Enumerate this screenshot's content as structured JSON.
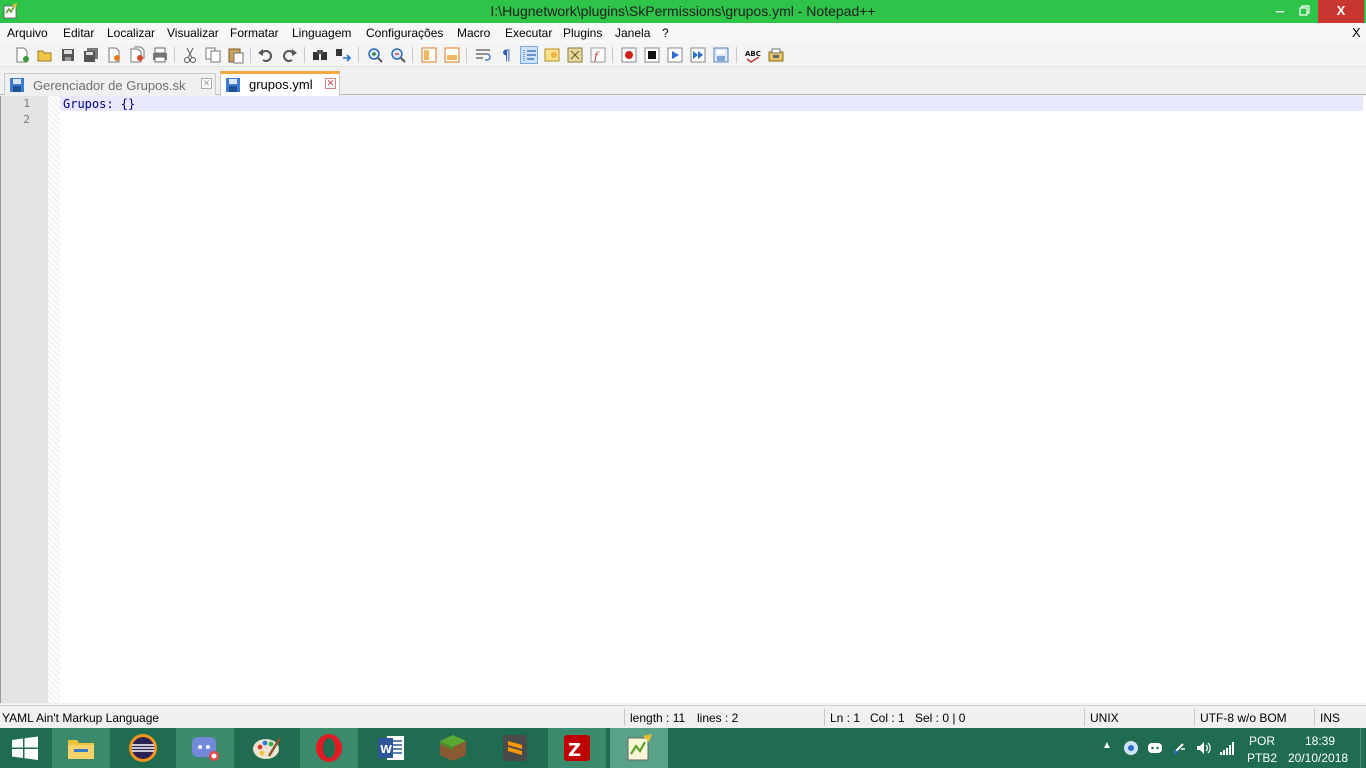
{
  "window": {
    "title": "I:\\Hugnetwork\\plugins\\SkPermissions\\grupos.yml - Notepad++",
    "minimize_label": "—",
    "maximize_label": "❐",
    "close_label": "X"
  },
  "menu": {
    "items": [
      "Arquivo",
      "Editar",
      "Localizar",
      "Visualizar",
      "Formatar",
      "Linguagem",
      "Configurações",
      "Macro",
      "Executar",
      "Plugins",
      "Janela",
      "?"
    ],
    "close_doc_label": "X"
  },
  "toolbar": {
    "icons": [
      "new-file",
      "open-file",
      "save",
      "save-all",
      "close",
      "close-all",
      "print",
      "cut",
      "copy",
      "paste",
      "undo",
      "redo",
      "find",
      "replace",
      "zoom-in",
      "zoom-out",
      "sync-vertical",
      "sync-horizontal",
      "word-wrap",
      "show-all-characters",
      "indent-guide",
      "user-defined-language",
      "document-map",
      "function-list",
      "record-macro",
      "stop-recording",
      "play-macro",
      "run-macro-multiple",
      "save-macro",
      "spell-check",
      "plugin"
    ]
  },
  "tabs": [
    {
      "label": "Gerenciador de Grupos.sk",
      "active": false
    },
    {
      "label": "grupos.yml",
      "active": true
    }
  ],
  "editor": {
    "lines": [
      {
        "number": "1",
        "text": "Grupos: {}"
      },
      {
        "number": "2",
        "text": ""
      }
    ],
    "text_color": "#000088",
    "current_line_color": "#e8e8ff"
  },
  "statusbar": {
    "language": "YAML Ain't Markup Language",
    "length": "length : 11",
    "lines": "lines : 2",
    "ln": "Ln : 1",
    "col": "Col : 1",
    "sel": "Sel : 0 | 0",
    "eol": "UNIX",
    "encoding": "UTF-8 w/o BOM",
    "mode": "INS"
  },
  "taskbar": {
    "apps": [
      "file-explorer",
      "eclipse",
      "discord",
      "paint",
      "opera",
      "word",
      "minecraft",
      "sublime-text",
      "filezilla",
      "notepad-plus-plus"
    ],
    "tray": {
      "lang_top": "POR",
      "lang_bottom": "PTB2",
      "time": "18:39",
      "date": "20/10/2018"
    },
    "accent_color": "#1f6c50"
  }
}
